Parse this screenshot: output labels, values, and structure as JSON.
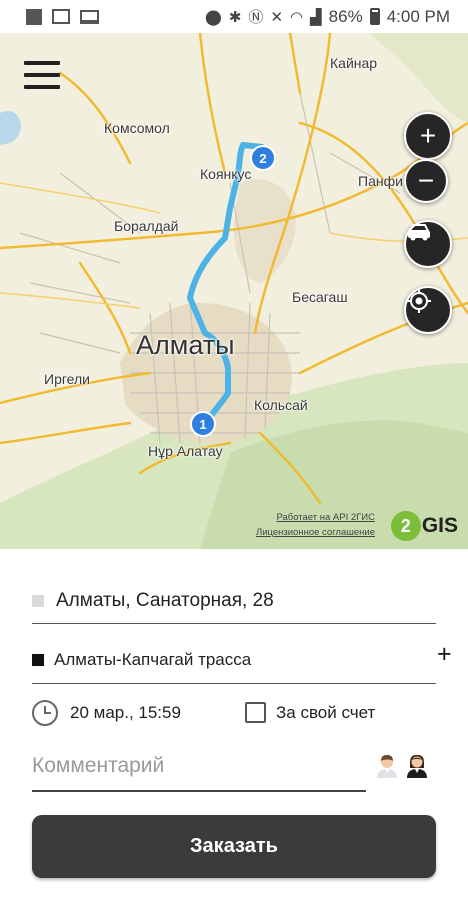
{
  "status_bar": {
    "battery": "86%",
    "time": "4:00 PM",
    "icons": [
      "notification-square-icon",
      "image-icon",
      "monitor-icon",
      "location-icon",
      "bluetooth-icon",
      "nfc-icon",
      "mute-icon",
      "wifi-icon",
      "signal-icon",
      "battery-icon"
    ]
  },
  "map": {
    "labels": {
      "kainar": "Кайнар",
      "komsomol": "Комсомол",
      "koyankus": "Коянкус",
      "panfilov": "Панфи",
      "boraldai": "Боралдай",
      "besagash": "Бесагаш",
      "almaty": "Алматы",
      "irgeli": "Иргели",
      "kolsai": "Кольсай",
      "nur_alatau": "Нұр Алатау"
    },
    "markers": {
      "start": "1",
      "end": "2"
    },
    "attribution": "Работает на API 2ГИС",
    "license": "Лицензионное соглашение",
    "logo_mark": "2",
    "logo_text": "GIS",
    "zoom_in": "+",
    "zoom_out": "−",
    "route_color": "#4db3e6"
  },
  "form": {
    "from_address": "Алматы, Санаторная, 28",
    "to_address": "Алматы-Капчагай трасса",
    "add_stop": "+",
    "datetime": "20 мар., 15:59",
    "own_account_label": "За свой счет",
    "own_account_checked": false,
    "comment_placeholder": "Комментарий",
    "comment_value": "",
    "order_button": "Заказать"
  }
}
